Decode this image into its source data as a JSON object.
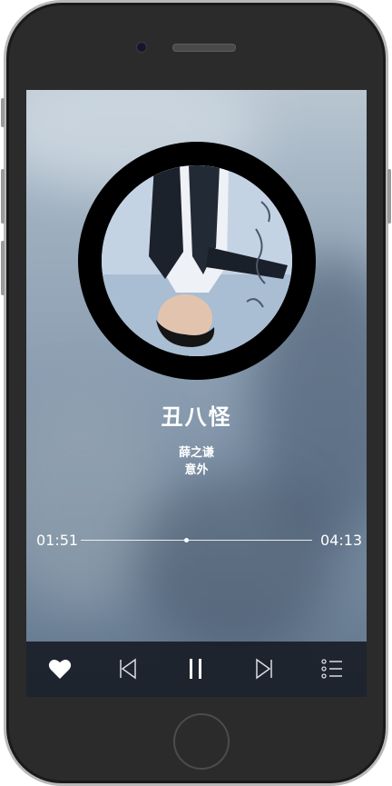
{
  "player": {
    "song_title": "丑八怪",
    "artist": "薛之谦",
    "album": "意外",
    "current_time": "01:51",
    "total_time": "04:13",
    "progress": 0.455,
    "liked": true,
    "state": "playing"
  },
  "controls": [
    {
      "name": "like-button",
      "icon": "heart-icon"
    },
    {
      "name": "previous-button",
      "icon": "previous-icon"
    },
    {
      "name": "pause-button",
      "icon": "pause-icon"
    },
    {
      "name": "next-button",
      "icon": "next-icon"
    },
    {
      "name": "playlist-button",
      "icon": "playlist-icon"
    }
  ],
  "colors": {
    "accent": "#ffffff",
    "control_bar": "#141921",
    "disc": "#000000",
    "phone_frame": "#2b2b2b"
  }
}
